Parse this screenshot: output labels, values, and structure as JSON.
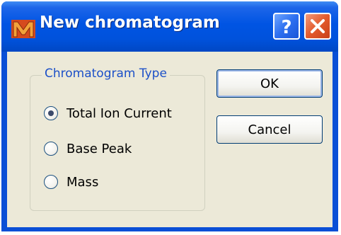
{
  "window": {
    "title": "New chromatogram",
    "app_icon": "m-logo-icon",
    "help_button_icon": "help-icon",
    "close_button_icon": "close-icon"
  },
  "group": {
    "label": "Chromatogram Type",
    "options": [
      {
        "label": "Total Ion Current",
        "checked": true
      },
      {
        "label": "Base Peak",
        "checked": false
      },
      {
        "label": "Mass",
        "checked": false
      }
    ]
  },
  "buttons": {
    "ok_label": "OK",
    "cancel_label": "Cancel"
  },
  "colors": {
    "titlebar": "#0054e3",
    "client_bg": "#ece9d8",
    "group_label": "#1c50c8",
    "close_button": "#e35a2c"
  }
}
